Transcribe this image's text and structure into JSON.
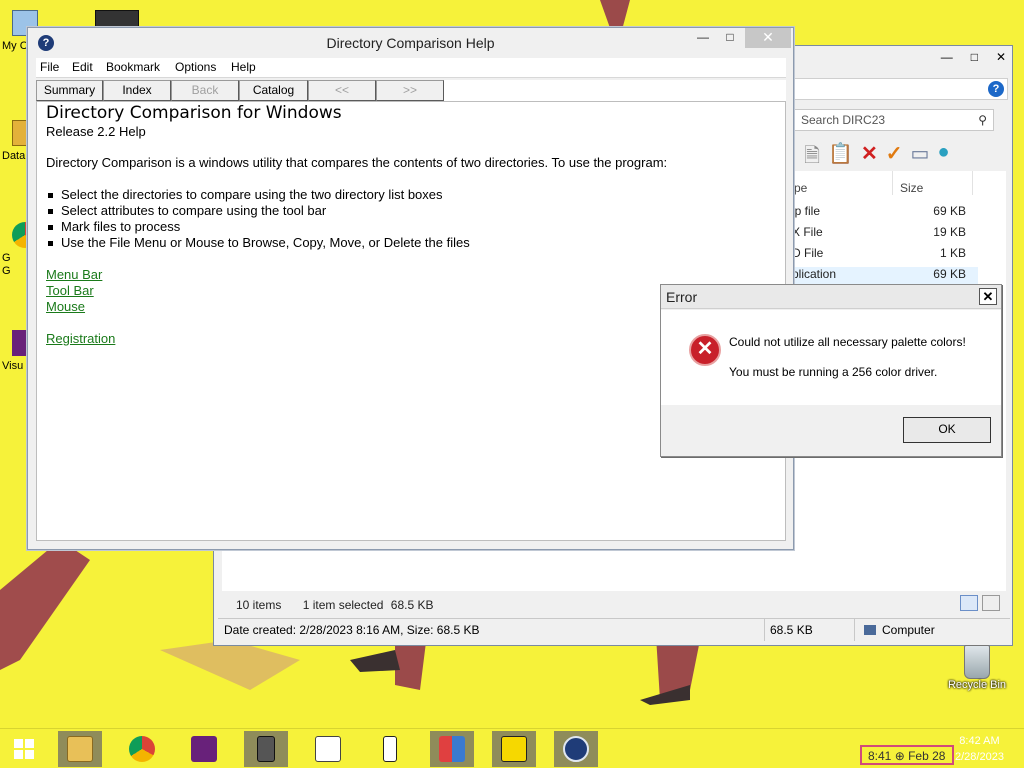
{
  "desktop": {
    "icons": [
      {
        "label": "My C",
        "icon": "computer-icon"
      },
      {
        "label": "Data",
        "icon": "network-icon"
      },
      {
        "label": "G\nG",
        "icon": "chrome-shortcut-icon"
      },
      {
        "label": "Visu",
        "icon": "visual-studio-icon"
      }
    ],
    "recycle_bin": "Recycle Bin"
  },
  "explorer": {
    "search_placeholder": "Search DIRC23",
    "col_type": "pe",
    "col_size": "Size",
    "files": [
      {
        "type": "lp file",
        "size": "69 KB"
      },
      {
        "type": "X File",
        "size": "19 KB"
      },
      {
        "type": "D File",
        "size": "1 KB"
      },
      {
        "type": "plication",
        "size": "69 KB",
        "selected": true
      }
    ],
    "status": {
      "items": "10 items",
      "selected": "1 item selected",
      "selected_size": "68.5 KB",
      "details": "Date created: 2/28/2023 8:16 AM, Size: 68.5 KB",
      "size": "68.5 KB",
      "location": "Computer"
    }
  },
  "help": {
    "title": "Directory Comparison Help",
    "menu": [
      "File",
      "Edit",
      "Bookmark",
      "Options",
      "Help"
    ],
    "buttons": [
      {
        "label": "Summary",
        "enabled": true
      },
      {
        "label": "Index",
        "enabled": true
      },
      {
        "label": "Back",
        "enabled": false
      },
      {
        "label": "Catalog",
        "enabled": true
      },
      {
        "label": "<<",
        "enabled": false
      },
      {
        "label": ">>",
        "enabled": false
      }
    ],
    "heading": "Directory Comparison for Windows",
    "subheading": "Release 2.2 Help",
    "intro": "Directory Comparison is a windows utility that compares the contents of two directories.  To use the program:",
    "bullets": [
      "Select the directories to compare using the two directory list boxes",
      "Select attributes to compare using the tool bar",
      "Mark files to process",
      "Use the File Menu or Mouse to Browse, Copy, Move, or Delete the files"
    ],
    "links": [
      "Menu Bar",
      "Tool Bar",
      "Mouse",
      "Registration"
    ]
  },
  "error_dialog": {
    "title": "Error",
    "message1": "Could not utilize all necessary palette colors!",
    "message2": "You must be running a 256 color driver.",
    "ok_label": "OK"
  },
  "taskbar": {
    "tray_text": "8:41 ⊕ Feb 28",
    "clock_time": "8:42 AM",
    "clock_date": "2/28/2023"
  },
  "colors": {
    "desktop": "#f6f23a",
    "link": "#1a7a1a",
    "error_icon": "#c8202a"
  }
}
